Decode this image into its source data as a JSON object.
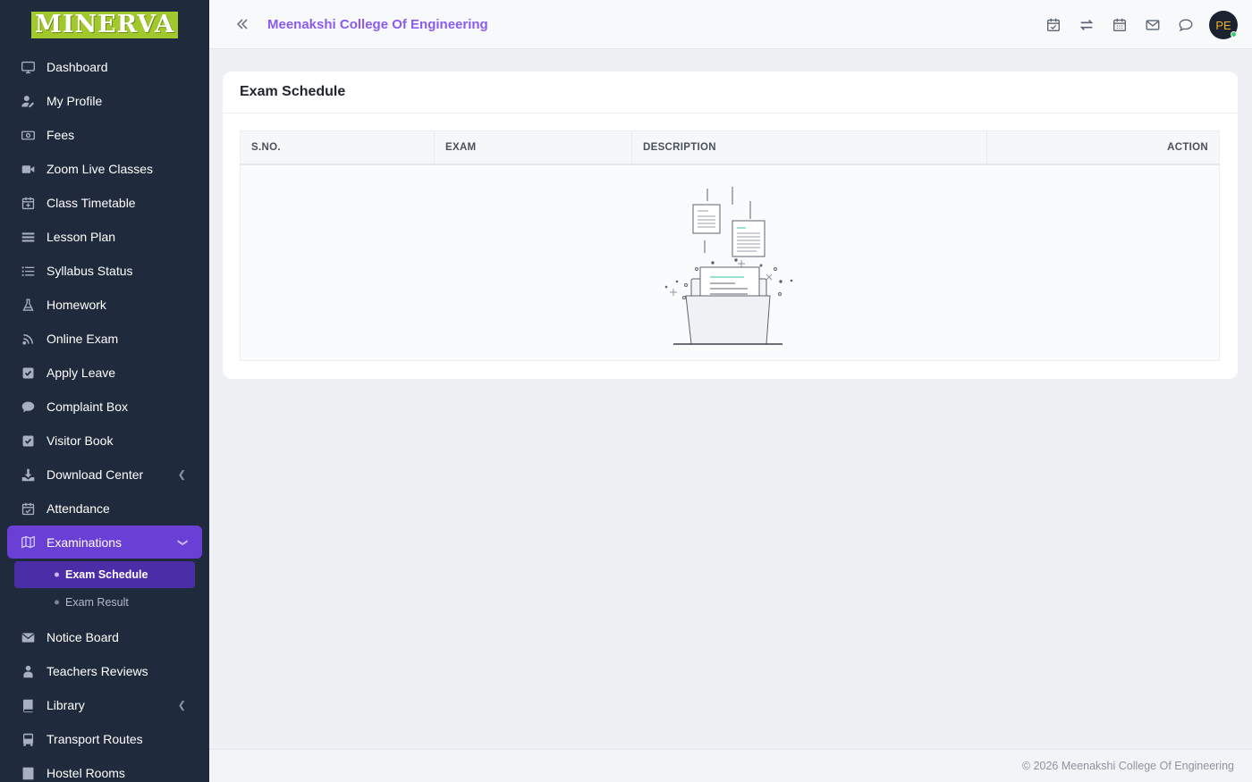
{
  "brand": {
    "logo_text": "MINERVA",
    "logo_color": "#a2c92c"
  },
  "college": {
    "name": "Meenakshi College Of Engineering"
  },
  "sidebar": {
    "items": [
      {
        "label": "Dashboard",
        "icon": "monitor-icon"
      },
      {
        "label": "My Profile",
        "icon": "user-edit-icon"
      },
      {
        "label": "Fees",
        "icon": "money-icon"
      },
      {
        "label": "Zoom Live Classes",
        "icon": "video-icon"
      },
      {
        "label": "Class Timetable",
        "icon": "calendar-plus-icon"
      },
      {
        "label": "Lesson Plan",
        "icon": "list-icon"
      },
      {
        "label": "Syllabus Status",
        "icon": "list-ordered-icon"
      },
      {
        "label": "Homework",
        "icon": "flask-icon"
      },
      {
        "label": "Online Exam",
        "icon": "rss-icon"
      },
      {
        "label": "Apply Leave",
        "icon": "check-square-icon"
      },
      {
        "label": "Complaint Box",
        "icon": "comment-icon"
      },
      {
        "label": "Visitor Book",
        "icon": "check-square-icon"
      },
      {
        "label": "Download Center",
        "icon": "download-icon"
      },
      {
        "label": "Attendance",
        "icon": "calendar-check-icon"
      },
      {
        "label": "Examinations",
        "icon": "map-icon"
      },
      {
        "label": "Notice Board",
        "icon": "envelope-icon"
      },
      {
        "label": "Teachers Reviews",
        "icon": "teacher-icon"
      },
      {
        "label": "Library",
        "icon": "book-icon"
      },
      {
        "label": "Transport Routes",
        "icon": "bus-icon"
      },
      {
        "label": "Hostel Rooms",
        "icon": "building-icon"
      }
    ],
    "examinations_sub": [
      {
        "label": "Exam Schedule"
      },
      {
        "label": "Exam Result"
      }
    ]
  },
  "page": {
    "title": "Exam Schedule",
    "table": {
      "columns": [
        "S.NO.",
        "EXAM",
        "DESCRIPTION",
        "ACTION"
      ],
      "rows": []
    }
  },
  "footer": {
    "text": "© 2026 Meenakshi College Of Engineering"
  },
  "user": {
    "initials": "PE"
  },
  "colors": {
    "accent": "#6a3fd6",
    "sidebar_bg": "#1f2a3c",
    "title": "#8a5cf2"
  }
}
